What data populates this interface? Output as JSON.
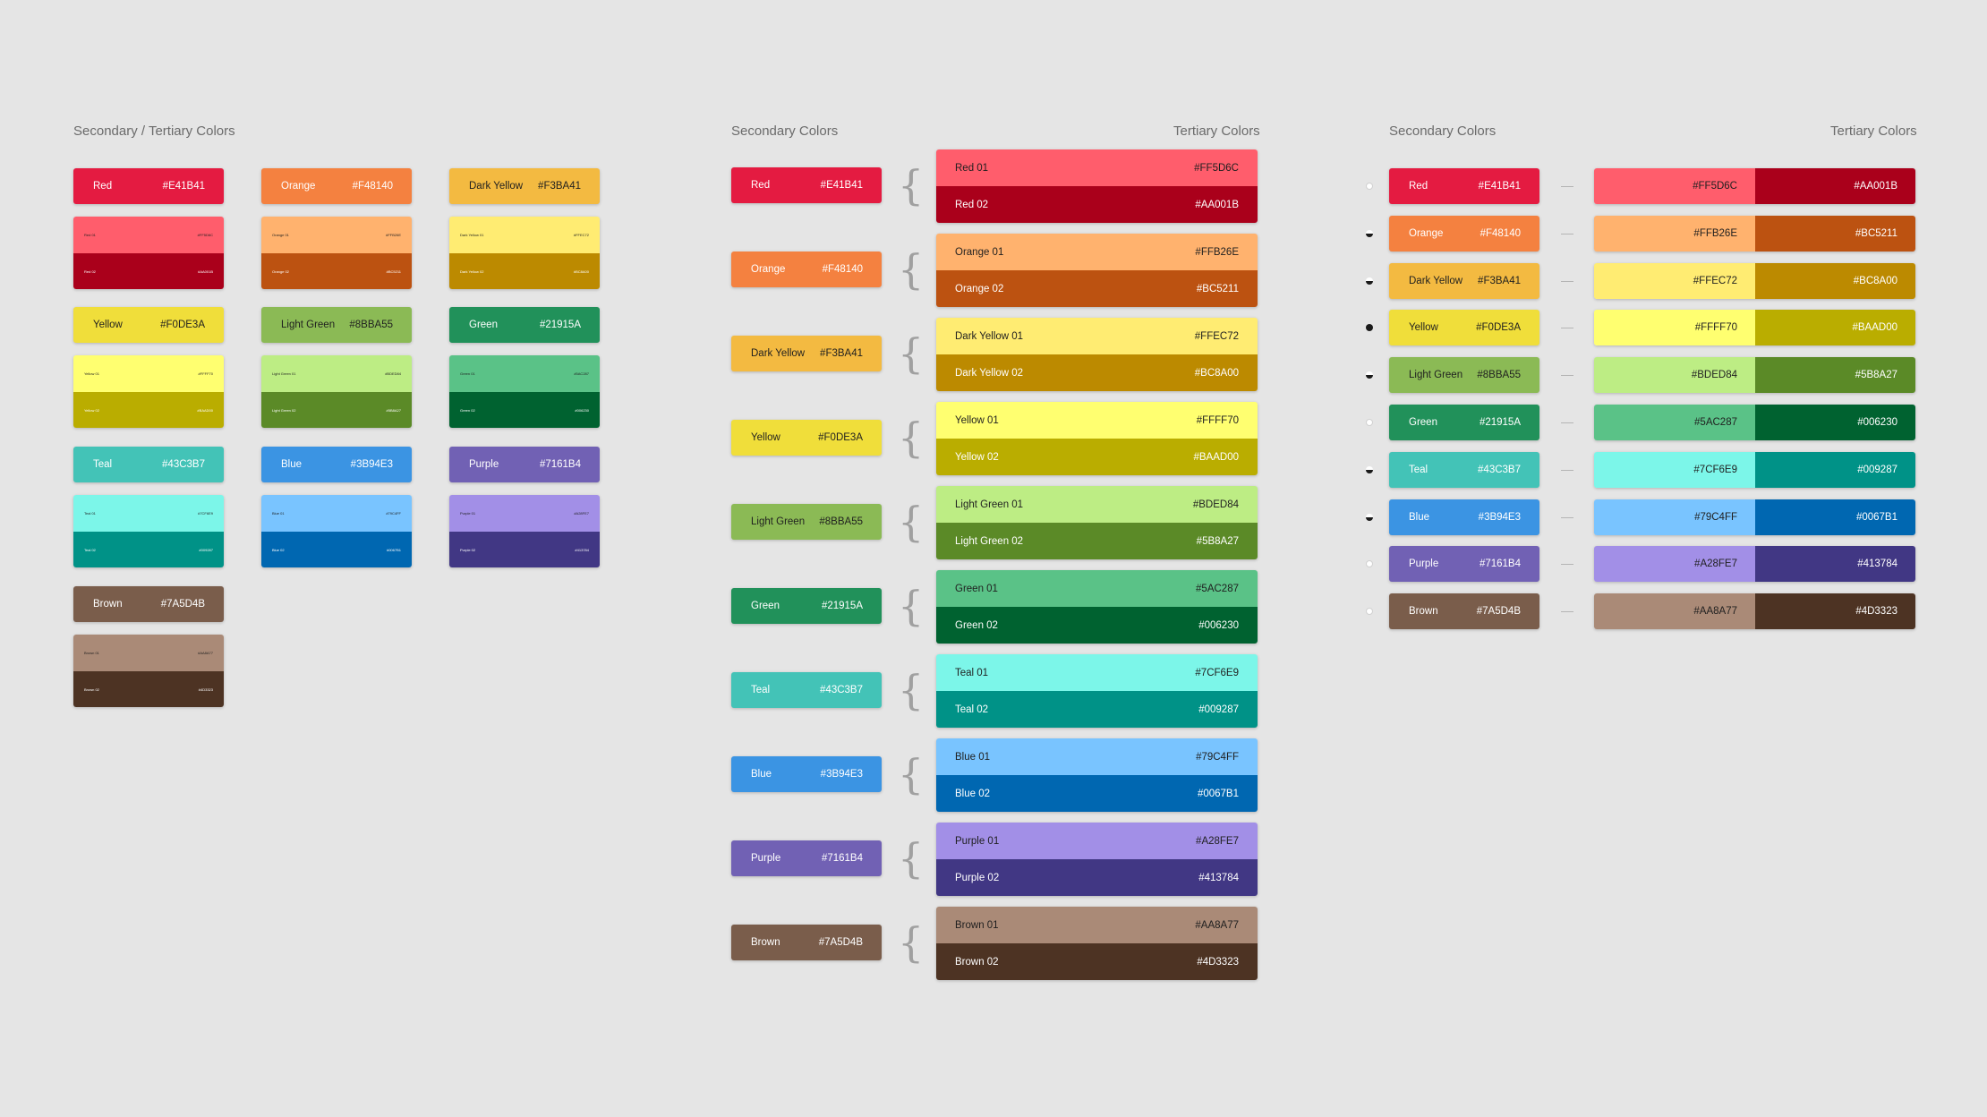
{
  "titles": {
    "p1_left": "Secondary / Tertiary Colors",
    "p2_left": "Secondary Colors",
    "p2_right": "Tertiary Colors",
    "p3_left": "Secondary Colors",
    "p3_right": "Tertiary Colors"
  },
  "colors": [
    {
      "name": "Red",
      "hex": "#E41B41",
      "t1_name": "Red 01",
      "t1_hex": "#FF5D6C",
      "t2_name": "Red 02",
      "t2_hex": "#AA001B"
    },
    {
      "name": "Orange",
      "hex": "#F48140",
      "t1_name": "Orange 01",
      "t1_hex": "#FFB26E",
      "t2_name": "Orange 02",
      "t2_hex": "#BC5211"
    },
    {
      "name": "Dark Yellow",
      "hex": "#F3BA41",
      "t1_name": "Dark Yellow 01",
      "t1_hex": "#FFEC72",
      "t2_name": "Dark Yellow 02",
      "t2_hex": "#BC8A00"
    },
    {
      "name": "Yellow",
      "hex": "#F0DE3A",
      "t1_name": "Yellow 01",
      "t1_hex": "#FFFF70",
      "t2_name": "Yellow 02",
      "t2_hex": "#BAAD00"
    },
    {
      "name": "Light Green",
      "hex": "#8BBA55",
      "t1_name": "Light Green 01",
      "t1_hex": "#BDED84",
      "t2_name": "Light Green 02",
      "t2_hex": "#5B8A27"
    },
    {
      "name": "Green",
      "hex": "#21915A",
      "t1_name": "Green 01",
      "t1_hex": "#5AC287",
      "t2_name": "Green 02",
      "t2_hex": "#006230"
    },
    {
      "name": "Teal",
      "hex": "#43C3B7",
      "t1_name": "Teal 01",
      "t1_hex": "#7CF6E9",
      "t2_name": "Teal 02",
      "t2_hex": "#009287"
    },
    {
      "name": "Blue",
      "hex": "#3B94E3",
      "t1_name": "Blue 01",
      "t1_hex": "#79C4FF",
      "t2_name": "Blue 02",
      "t2_hex": "#0067B1"
    },
    {
      "name": "Purple",
      "hex": "#7161B4",
      "t1_name": "Purple 01",
      "t1_hex": "#A28FE7",
      "t2_name": "Purple 02",
      "t2_hex": "#413784"
    },
    {
      "name": "Brown",
      "hex": "#7A5D4B",
      "t1_name": "Brown 01",
      "t1_hex": "#AA8A77",
      "t2_name": "Brown 02",
      "t2_hex": "#4D3323"
    }
  ],
  "text_colors": {
    "on_secondary": [
      "light",
      "light",
      "dark",
      "dark",
      "dark",
      "light",
      "light",
      "light",
      "light",
      "light"
    ],
    "on_tertiary_01": [
      "dark",
      "dark",
      "dark",
      "dark",
      "dark",
      "dark",
      "dark",
      "dark",
      "dark",
      "dark"
    ],
    "on_tertiary_02": [
      "light",
      "light",
      "light",
      "light",
      "light",
      "light",
      "light",
      "light",
      "light",
      "light"
    ]
  },
  "row_markers": [
    "empty",
    "half",
    "half",
    "full",
    "half",
    "empty",
    "half",
    "half",
    "empty",
    "empty"
  ]
}
